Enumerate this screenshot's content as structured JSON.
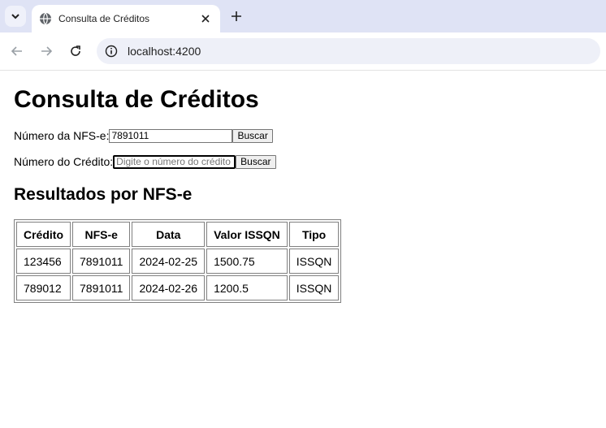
{
  "browser": {
    "tab_title": "Consulta de Créditos",
    "url": "localhost:4200"
  },
  "page": {
    "title": "Consulta de Créditos",
    "nfse_label": "Número da NFS-e:",
    "nfse_value": "7891011",
    "nfse_button": "Buscar",
    "credito_label": "Número do Crédito:",
    "credito_placeholder": "Digite o número do crédito",
    "credito_value": "",
    "credito_button": "Buscar",
    "results_title": "Resultados por NFS-e",
    "table": {
      "headers": [
        "Crédito",
        "NFS-e",
        "Data",
        "Valor ISSQN",
        "Tipo"
      ],
      "rows": [
        [
          "123456",
          "7891011",
          "2024-02-25",
          "1500.75",
          "ISSQN"
        ],
        [
          "789012",
          "7891011",
          "2024-02-26",
          "1200.5",
          "ISSQN"
        ]
      ]
    }
  }
}
